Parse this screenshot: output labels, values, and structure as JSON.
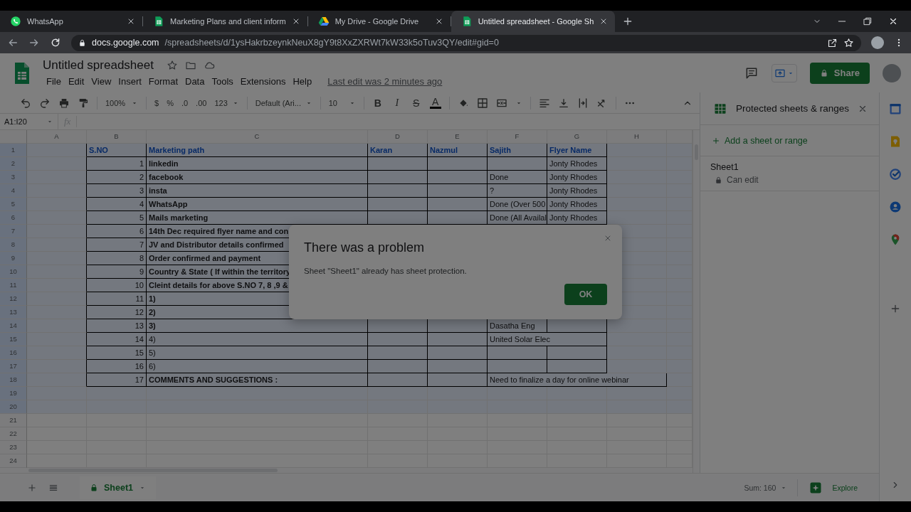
{
  "browser": {
    "tabs": [
      {
        "title": "WhatsApp",
        "selected": false
      },
      {
        "title": "Marketing Plans and client inform",
        "selected": false
      },
      {
        "title": "My Drive - Google Drive",
        "selected": false
      },
      {
        "title": "Untitled spreadsheet - Google Sh",
        "selected": true
      }
    ],
    "address": {
      "host": "docs.google.com",
      "path": "/spreadsheets/d/1ysHakrbzeynkNeuX8gY9t8XxZXRWt7kW33k5oTuv3QY/edit#gid=0"
    }
  },
  "document": {
    "title": "Untitled spreadsheet",
    "menu": [
      "File",
      "Edit",
      "View",
      "Insert",
      "Format",
      "Data",
      "Tools",
      "Extensions",
      "Help"
    ],
    "last_edit": "Last edit was 2 minutes ago",
    "share_button": "Share"
  },
  "toolbar": {
    "zoom": "100%",
    "currency": "$",
    "percent": "%",
    "decimal_decrease": ".0",
    "decimal_increase": ".00",
    "number_format": "123",
    "font": "Default (Ari...",
    "font_size": "10",
    "bold": "B",
    "italic": "I",
    "strikethrough": "S",
    "text_color": "A"
  },
  "formula_bar": {
    "name_box": "A1:I20",
    "fx": "fx"
  },
  "grid": {
    "columns": [
      "A",
      "B",
      "C",
      "D",
      "E",
      "F",
      "G",
      "H"
    ],
    "rows": [
      {
        "number": "1",
        "kind": "header",
        "selected": true,
        "cells": {
          "B": "S.NO",
          "C": "Marketing path",
          "D": "Karan",
          "E": "Nazmul",
          "F": "Sajith",
          "G": "Flyer Name"
        }
      },
      {
        "number": "2",
        "kind": "bold",
        "selected": true,
        "cells": {
          "B": "1",
          "C": "linkedin",
          "G": "Jonty Rhodes"
        }
      },
      {
        "number": "3",
        "kind": "bold",
        "selected": true,
        "cells": {
          "B": "2",
          "C": "facebook",
          "F": "Done",
          "G": "Jonty Rhodes"
        }
      },
      {
        "number": "4",
        "kind": "bold",
        "selected": true,
        "cells": {
          "B": "3",
          "C": "insta",
          "F": "?",
          "G": "Jonty Rhodes"
        }
      },
      {
        "number": "5",
        "kind": "bold",
        "selected": true,
        "cells": {
          "B": "4",
          "C": "WhatsApp",
          "F": "Done (Over 500",
          "G": "Jonty Rhodes"
        }
      },
      {
        "number": "6",
        "kind": "bold",
        "selected": true,
        "cells": {
          "B": "5",
          "C": "Mails marketing",
          "F": "Done (All Availal",
          "G": "Jonty Rhodes"
        }
      },
      {
        "number": "7",
        "kind": "bold",
        "selected": true,
        "cells": {
          "B": "6",
          "C": "14th Dec required flyer name and con"
        }
      },
      {
        "number": "8",
        "kind": "bold",
        "selected": true,
        "cells": {
          "B": "7",
          "C": "JV and Distributor details confirmed"
        }
      },
      {
        "number": "9",
        "kind": "bold",
        "selected": true,
        "cells": {
          "B": "8",
          "C": "Order confirmed and payment"
        }
      },
      {
        "number": "10",
        "kind": "bold",
        "selected": true,
        "cells": {
          "B": "9",
          "C": "Country & State ( If within the territory"
        }
      },
      {
        "number": "11",
        "kind": "bold",
        "selected": true,
        "cells": {
          "B": "10",
          "C": "Cleint details for above S.NO 7, 8 ,9 &"
        }
      },
      {
        "number": "12",
        "kind": "bold",
        "selected": true,
        "cells": {
          "B": "11",
          "C": "1)"
        }
      },
      {
        "number": "13",
        "kind": "bold",
        "selected": true,
        "cells": {
          "B": "12",
          "C": "2)"
        }
      },
      {
        "number": "14",
        "kind": "bold",
        "selected": true,
        "cells": {
          "B": "13",
          "C": "3)",
          "F": "Dasatha Eng"
        }
      },
      {
        "number": "15",
        "kind": "plain",
        "selected": true,
        "cells": {
          "B": "14",
          "C": "4)",
          "F": "United Solar Elec"
        }
      },
      {
        "number": "16",
        "kind": "plain",
        "selected": true,
        "cells": {
          "B": "15",
          "C": "5)"
        }
      },
      {
        "number": "17",
        "kind": "plain",
        "selected": true,
        "cells": {
          "B": "16",
          "C": "6)"
        }
      },
      {
        "number": "18",
        "kind": "bold",
        "selected": true,
        "cells": {
          "B": "17",
          "C": "COMMENTS AND SUGGESTIONS :",
          "F": "Need to finalize a day for online webinar"
        }
      },
      {
        "number": "19",
        "kind": "empty",
        "selected": true,
        "cells": {}
      },
      {
        "number": "20",
        "kind": "empty",
        "selected": true,
        "cells": {}
      },
      {
        "number": "21",
        "kind": "empty",
        "selected": false,
        "cells": {}
      },
      {
        "number": "22",
        "kind": "empty",
        "selected": false,
        "cells": {}
      },
      {
        "number": "23",
        "kind": "empty",
        "selected": false,
        "cells": {}
      },
      {
        "number": "24",
        "kind": "empty",
        "selected": false,
        "cells": {}
      }
    ]
  },
  "side_panel": {
    "title": "Protected sheets & ranges",
    "add_link": "Add a sheet or range",
    "items": [
      {
        "name": "Sheet1",
        "permission": "Can edit"
      }
    ]
  },
  "bottom_bar": {
    "sheets": [
      {
        "name": "Sheet1",
        "selected": true
      }
    ],
    "sum": "Sum: 160",
    "explore": "Explore"
  },
  "dialog": {
    "title": "There was a problem",
    "message": "Sheet \"Sheet1\" already has sheet protection.",
    "button": "OK"
  }
}
